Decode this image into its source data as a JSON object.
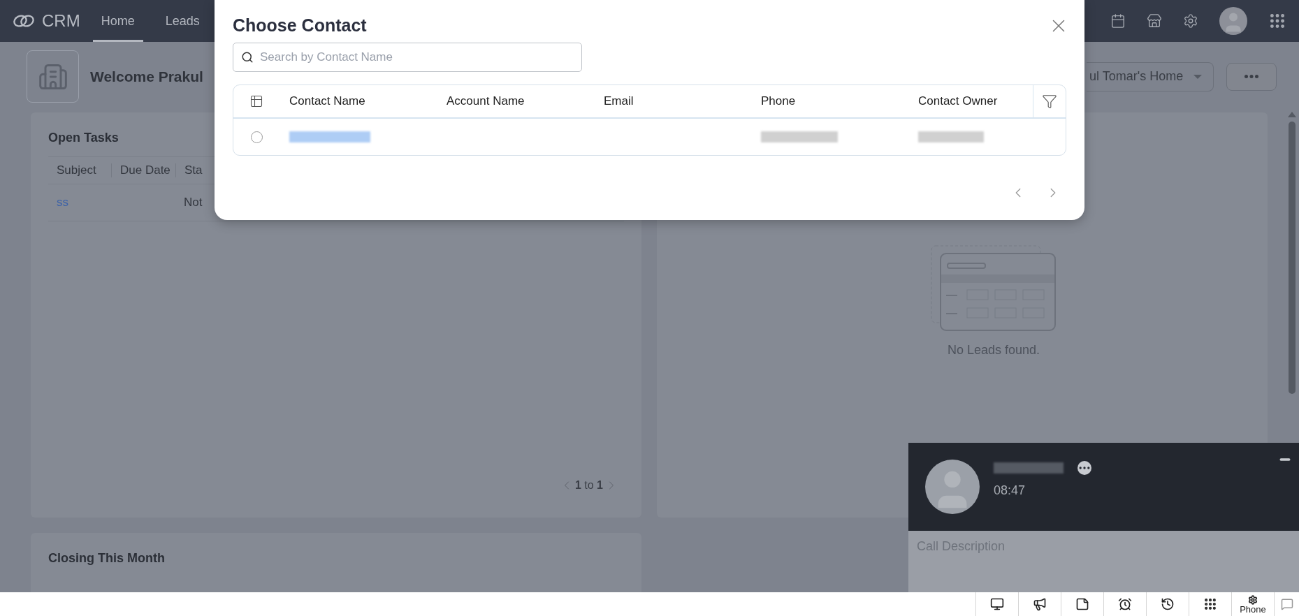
{
  "nav": {
    "logo": "CRM",
    "tabs": [
      {
        "label": "Home",
        "selected": true
      },
      {
        "label": "Leads",
        "selected": false
      }
    ]
  },
  "header": {
    "welcome": "Welcome Prakul",
    "home_selector": "ul Tomar's Home"
  },
  "open_tasks": {
    "title": "Open Tasks",
    "columns": [
      "Subject",
      "Due Date",
      "Sta"
    ],
    "rows": [
      {
        "subject": "ss",
        "status": "Not"
      }
    ],
    "pagination": "**1** to **1**"
  },
  "leads_panel": {
    "empty_message": "No Leads found."
  },
  "closing": {
    "title": "Closing This Month"
  },
  "dialog": {
    "title": "Choose Contact",
    "search": {
      "placeholder": "Search by Contact Name"
    },
    "columns": [
      "Contact Name",
      "Account Name",
      "Email",
      "Phone",
      "Contact Owner"
    ],
    "rows": [
      {
        "selected": false
      }
    ]
  },
  "call": {
    "timer": "08:47",
    "description": {
      "placeholder": "Call Description"
    }
  },
  "bottom_bar": {
    "phone_label": "Phone"
  }
}
